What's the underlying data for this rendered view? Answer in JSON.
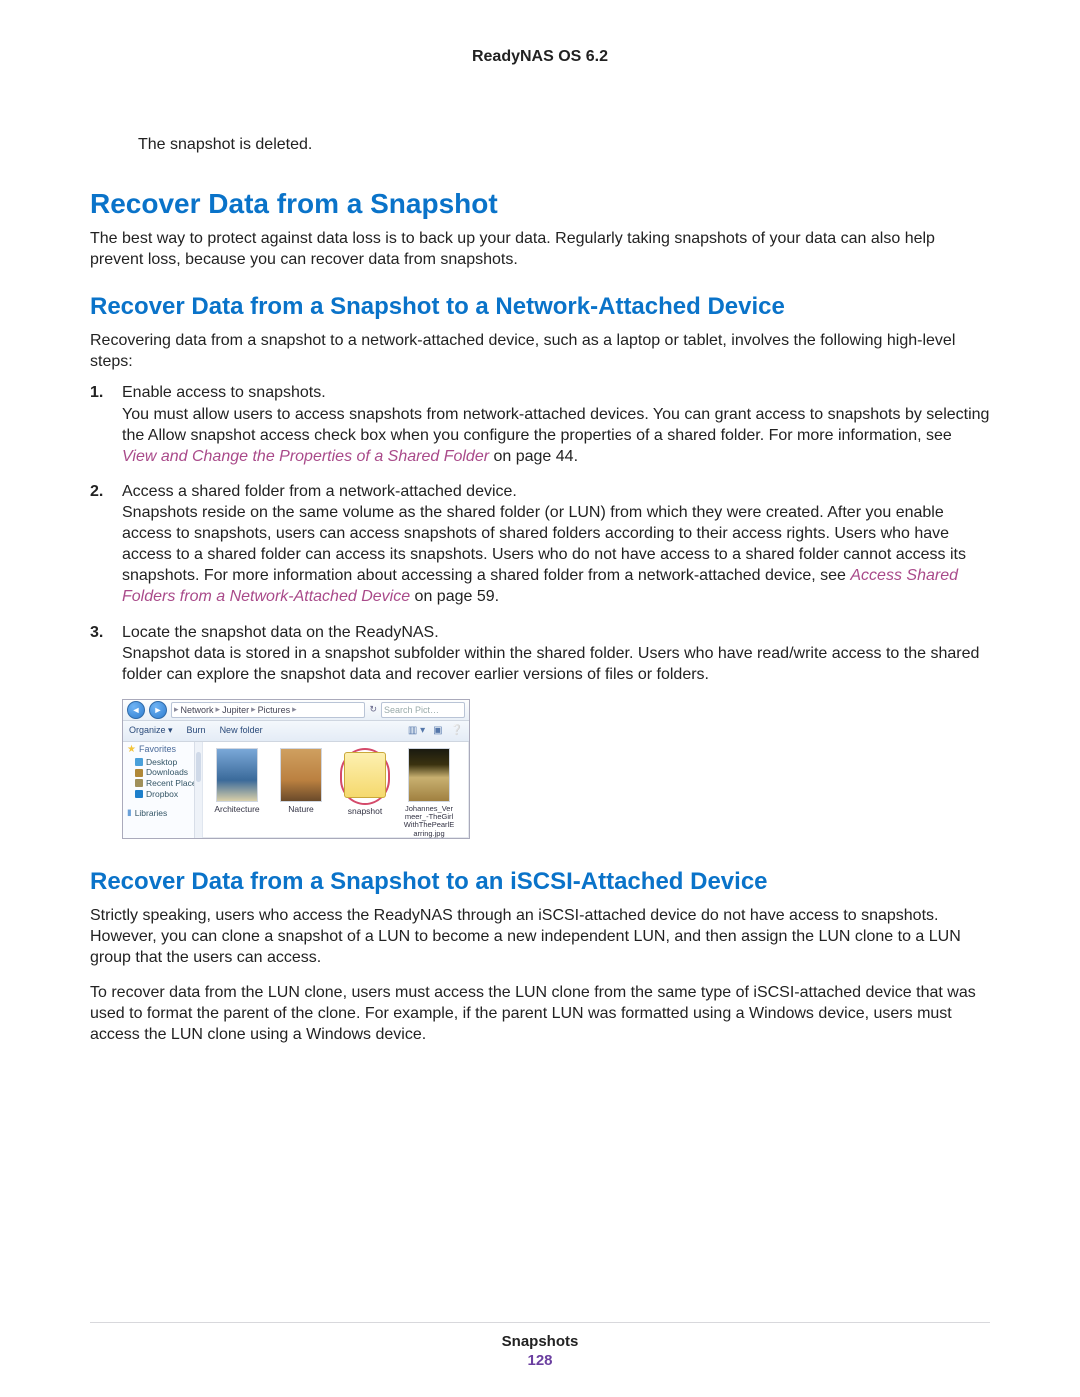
{
  "header": {
    "product": "ReadyNAS OS 6.2"
  },
  "opening_line": "The snapshot is deleted.",
  "section1": {
    "title": "Recover Data from a Snapshot",
    "intro": "The best way to protect against data loss is to back up your data. Regularly taking snapshots of your data can also help prevent loss, because you can recover data from snapshots."
  },
  "section2": {
    "title": "Recover Data from a Snapshot to a Network-Attached Device",
    "intro": "Recovering data from a snapshot to a network-attached device, such as a laptop or tablet, involves the following high-level steps:",
    "steps": [
      {
        "lead": "Enable access to snapshots.",
        "body1": "You must allow users to access snapshots from network-attached devices. You can grant access to snapshots by selecting the Allow snapshot access check box when you configure the properties of a shared folder. For more information, see ",
        "link1": "View and Change the Properties of a Shared Folder",
        "tail1": " on page 44."
      },
      {
        "lead": "Access a shared folder from a network-attached device.",
        "body1": "Snapshots reside on the same volume as the shared folder (or LUN) from which they were created. After you enable access to snapshots, users can access snapshots of shared folders according to their access rights. Users who have access to a shared folder can access its snapshots. Users who do not have access to a shared folder cannot access its snapshots. For more information about accessing a shared folder from a network-attached device, see ",
        "link1": "Access Shared Folders from a Network-Attached Device",
        "tail1": " on page 59."
      },
      {
        "lead": "Locate the snapshot data on the ReadyNAS.",
        "body1": "Snapshot data is stored in a snapshot subfolder within the shared folder. Users who have read/write access to the shared folder can explore the snapshot data and recover earlier versions of files or folders."
      }
    ]
  },
  "explorer": {
    "path": [
      "Network",
      "Jupiter",
      "Pictures"
    ],
    "search_placeholder": "Search Pict…",
    "toolbar": {
      "organize": "Organize ▾",
      "burn": "Burn",
      "newfolder": "New folder"
    },
    "sidebar": {
      "favorites": "Favorites",
      "items": [
        "Desktop",
        "Downloads",
        "Recent Places",
        "Dropbox"
      ],
      "libraries": "Libraries"
    },
    "items": [
      {
        "label": "Architecture"
      },
      {
        "label": "Nature"
      },
      {
        "label": "snapshot"
      },
      {
        "label": "Johannes_Vermeer_-TheGirlWithThePearlEarring.jpg"
      }
    ]
  },
  "section3": {
    "title": "Recover Data from a Snapshot to an iSCSI-Attached Device",
    "p1": "Strictly speaking, users who access the ReadyNAS through an iSCSI-attached device do not have access to snapshots. However, you can clone a snapshot of a LUN to become a new independent LUN, and then assign the LUN clone to a LUN group that the users can access.",
    "p2": "To recover data from the LUN clone, users must access the LUN clone from the same type of iSCSI-attached device that was used to format the parent of the clone. For example, if the parent LUN was formatted using a Windows device, users must access the LUN clone using a Windows device."
  },
  "footer": {
    "section": "Snapshots",
    "page": "128"
  }
}
